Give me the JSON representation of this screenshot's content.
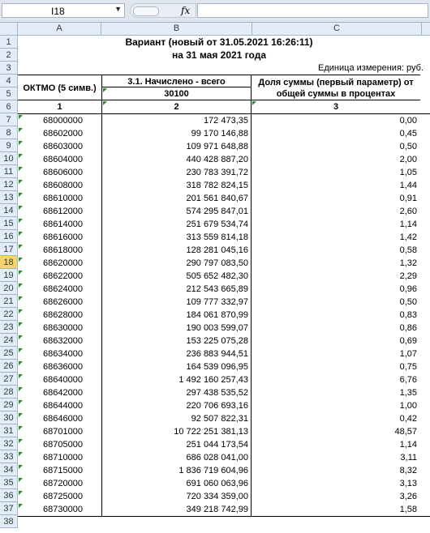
{
  "namebox": "I18",
  "fx_label": "fx",
  "columns": [
    "A",
    "B",
    "C"
  ],
  "title1": "Вариант (новый от 31.05.2021 16:26:11)",
  "title2": "на 31 мая 2021 года",
  "unit_note": "Единица измерения: руб.",
  "header": {
    "oktmo": "ОКТМО (5 симв.)",
    "accrued": "3.1. Начислено - всего",
    "accrued_code": "30100",
    "share": "Доля суммы (первый параметр) от общей суммы в процентах",
    "col_num1": "1",
    "col_num2": "2",
    "col_num3": "3"
  },
  "selected_row": 18,
  "row_numbers": [
    "1",
    "2",
    "3",
    "4",
    "5",
    "6",
    "7",
    "8",
    "9",
    "10",
    "11",
    "12",
    "13",
    "14",
    "15",
    "16",
    "17",
    "18",
    "19",
    "20",
    "21",
    "22",
    "23",
    "24",
    "25",
    "26",
    "27",
    "28",
    "29",
    "30",
    "31",
    "32",
    "33",
    "34",
    "35",
    "36",
    "37",
    "38"
  ],
  "rows": [
    {
      "oktmo": "68000000",
      "sum": "172 473,35",
      "pct": "0,00"
    },
    {
      "oktmo": "68602000",
      "sum": "99 170 146,88",
      "pct": "0,45"
    },
    {
      "oktmo": "68603000",
      "sum": "109 971 648,88",
      "pct": "0,50"
    },
    {
      "oktmo": "68604000",
      "sum": "440 428 887,20",
      "pct": "2,00"
    },
    {
      "oktmo": "68606000",
      "sum": "230 783 391,72",
      "pct": "1,05"
    },
    {
      "oktmo": "68608000",
      "sum": "318 782 824,15",
      "pct": "1,44"
    },
    {
      "oktmo": "68610000",
      "sum": "201 561 840,67",
      "pct": "0,91"
    },
    {
      "oktmo": "68612000",
      "sum": "574 295 847,01",
      "pct": "2,60"
    },
    {
      "oktmo": "68614000",
      "sum": "251 679 534,74",
      "pct": "1,14"
    },
    {
      "oktmo": "68616000",
      "sum": "313 559 814,18",
      "pct": "1,42"
    },
    {
      "oktmo": "68618000",
      "sum": "128 281 045,16",
      "pct": "0,58"
    },
    {
      "oktmo": "68620000",
      "sum": "290 797 083,50",
      "pct": "1,32"
    },
    {
      "oktmo": "68622000",
      "sum": "505 652 482,30",
      "pct": "2,29"
    },
    {
      "oktmo": "68624000",
      "sum": "212 543 665,89",
      "pct": "0,96"
    },
    {
      "oktmo": "68626000",
      "sum": "109 777 332,97",
      "pct": "0,50"
    },
    {
      "oktmo": "68628000",
      "sum": "184 061 870,99",
      "pct": "0,83"
    },
    {
      "oktmo": "68630000",
      "sum": "190 003 599,07",
      "pct": "0,86"
    },
    {
      "oktmo": "68632000",
      "sum": "153 225 075,28",
      "pct": "0,69"
    },
    {
      "oktmo": "68634000",
      "sum": "236 883 944,51",
      "pct": "1,07"
    },
    {
      "oktmo": "68636000",
      "sum": "164 539 096,95",
      "pct": "0,75"
    },
    {
      "oktmo": "68640000",
      "sum": "1 492 160 257,43",
      "pct": "6,76"
    },
    {
      "oktmo": "68642000",
      "sum": "297 438 535,52",
      "pct": "1,35"
    },
    {
      "oktmo": "68644000",
      "sum": "220 706 693,16",
      "pct": "1,00"
    },
    {
      "oktmo": "68646000",
      "sum": "92 507 822,31",
      "pct": "0,42"
    },
    {
      "oktmo": "68701000",
      "sum": "10 722 251 381,13",
      "pct": "48,57"
    },
    {
      "oktmo": "68705000",
      "sum": "251 044 173,54",
      "pct": "1,14"
    },
    {
      "oktmo": "68710000",
      "sum": "686 028 041,00",
      "pct": "3,11"
    },
    {
      "oktmo": "68715000",
      "sum": "1 836 719 604,96",
      "pct": "8,32"
    },
    {
      "oktmo": "68720000",
      "sum": "691 060 063,96",
      "pct": "3,13"
    },
    {
      "oktmo": "68725000",
      "sum": "720 334 359,00",
      "pct": "3,26"
    },
    {
      "oktmo": "68730000",
      "sum": "349 218 742,99",
      "pct": "1,58"
    }
  ]
}
